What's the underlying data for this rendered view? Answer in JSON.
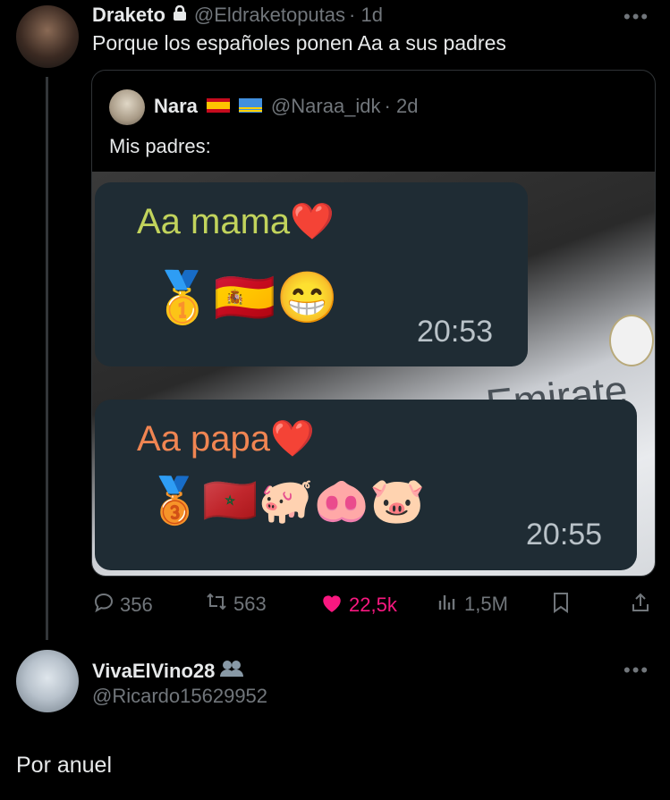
{
  "tweet": {
    "author_name": "Draketo",
    "handle": "@Eldraketoputas",
    "time": "· 1d",
    "text": "Porque los españoles ponen Aa a sus padres"
  },
  "quote": {
    "author_name": "Nara",
    "handle": "@Naraa_idk",
    "time": "· 2d",
    "text": "Mis padres:",
    "messages": [
      {
        "text": "Aa mama",
        "emojis": "🥇🇪🇸😁",
        "time": "20:53",
        "color": "#c1d35c"
      },
      {
        "text": "Aa papa",
        "emojis": "🥉🇲🇦🐖🐽🐷",
        "time": "20:55",
        "color": "#f08552"
      }
    ],
    "jersey_text": "Emirate"
  },
  "actions": {
    "replies": "356",
    "reposts": "563",
    "likes": "22,5k",
    "views": "1,5M"
  },
  "reply": {
    "author_name": "VivaElVino28",
    "handle": "@Ricardo15629952",
    "text": "Por anuel"
  },
  "colors": {
    "background": "#000000",
    "text": "#e7e9ea",
    "muted": "#71767b",
    "like": "#f91880",
    "bubble": "#1f2c34"
  }
}
